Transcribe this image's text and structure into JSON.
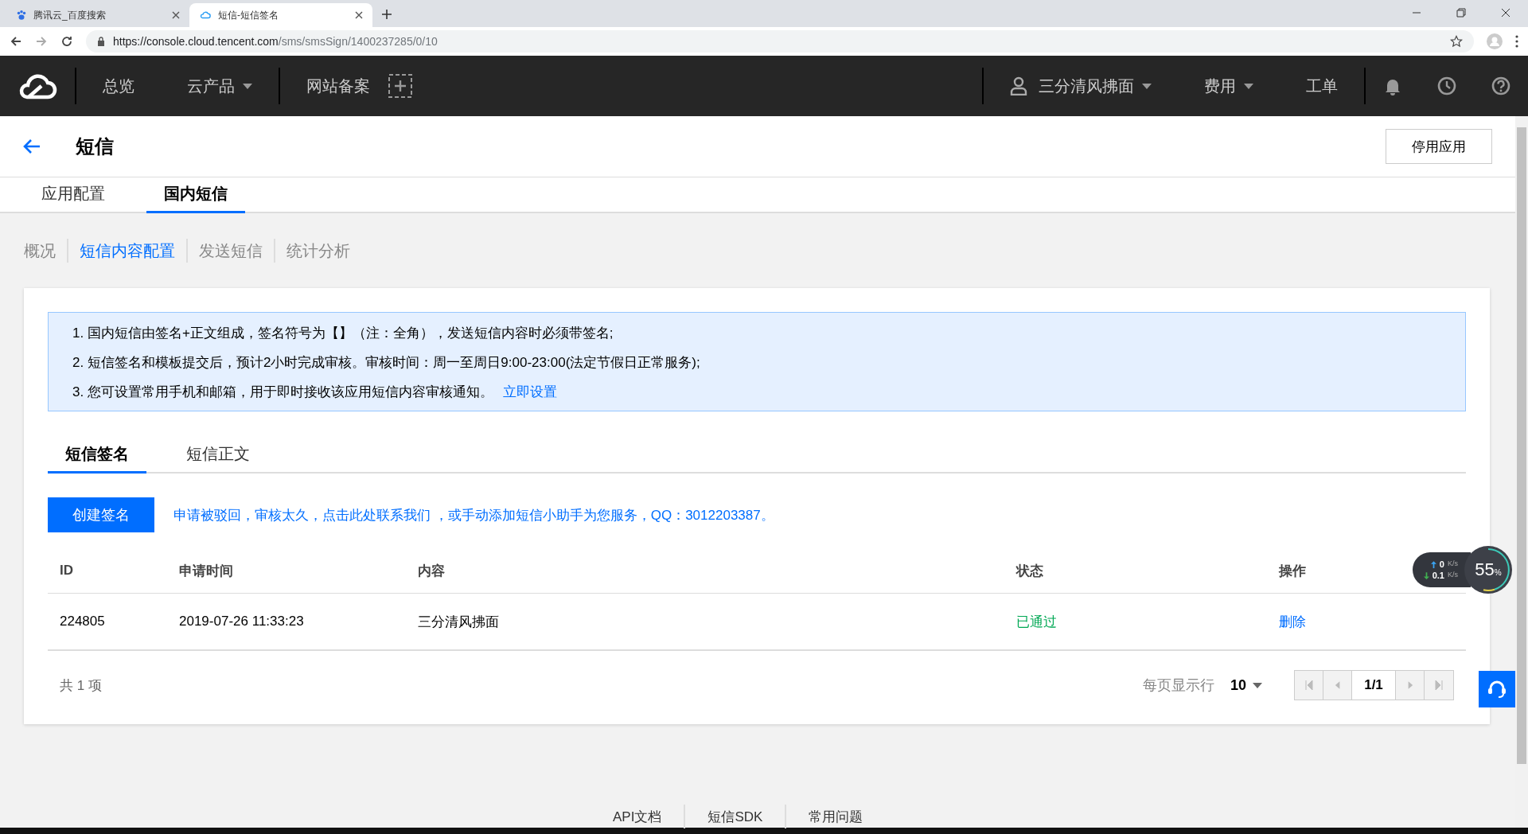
{
  "browser": {
    "tabs": [
      {
        "title": "腾讯云_百度搜索",
        "selected": false
      },
      {
        "title": "短信-短信签名",
        "selected": true
      }
    ],
    "url_host": "https://console.cloud.tencent.com",
    "url_path": "/sms/smsSign/1400237285/0/10"
  },
  "header": {
    "nav": [
      {
        "label": "总览",
        "dropdown": false
      },
      {
        "label": "云产品",
        "dropdown": true
      },
      {
        "label": "网站备案",
        "dropdown": false
      }
    ],
    "right": [
      {
        "label": "三分清风拂面",
        "dropdown": true,
        "kind": "account"
      },
      {
        "label": "费用",
        "dropdown": true,
        "kind": "menu"
      },
      {
        "label": "工单",
        "dropdown": false,
        "kind": "menu"
      }
    ]
  },
  "page": {
    "title": "短信",
    "stop_button": "停用应用",
    "tabs": [
      {
        "label": "应用配置",
        "selected": false
      },
      {
        "label": "国内短信",
        "selected": true
      }
    ],
    "subnav": [
      {
        "label": "概况",
        "selected": false
      },
      {
        "label": "短信内容配置",
        "selected": true
      },
      {
        "label": "发送短信",
        "selected": false
      },
      {
        "label": "统计分析",
        "selected": false
      }
    ]
  },
  "notices": [
    {
      "text": "1. 国内短信由签名+正文组成，签名符号为【】（注：全角），发送短信内容时必须带签名;"
    },
    {
      "text": "2. 短信签名和模板提交后，预计2小时完成审核。审核时间：周一至周日9:00-23:00(法定节假日正常服务);"
    },
    {
      "text": "3. 您可设置常用手机和邮箱，用于即时接收该应用短信内容审核通知。",
      "link": "立即设置"
    }
  ],
  "sign_tabs": [
    {
      "label": "短信签名",
      "selected": true
    },
    {
      "label": "短信正文",
      "selected": false
    }
  ],
  "create_button": "创建签名",
  "help_link": "申请被驳回，审核太久，点击此处联系我们 ，或手动添加短信小助手为您服务，QQ：3012203387。",
  "table": {
    "columns": [
      "ID",
      "申请时间",
      "内容",
      "状态",
      "操作"
    ],
    "rows": [
      {
        "id": "224805",
        "time": "2019-07-26 11:33:23",
        "content": "三分清风拂面",
        "status": "已通过",
        "action": "删除"
      }
    ]
  },
  "total": "共 1 项",
  "pagination": {
    "per_page_label": "每页显示行",
    "per_page": "10",
    "page": "1/1"
  },
  "footer_links": [
    "API文档",
    "短信SDK",
    "常用问题"
  ],
  "monitor": {
    "up": "0",
    "up_unit": "K/s",
    "down": "0.1",
    "down_unit": "K/s",
    "percent": "55",
    "percent_unit": "%"
  }
}
